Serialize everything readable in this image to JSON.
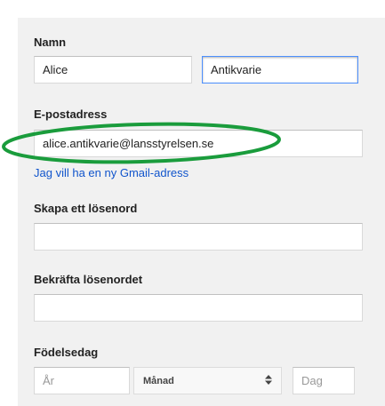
{
  "name_section": {
    "label": "Namn",
    "first_name_value": "Alice",
    "last_name_value": "Antikvarie"
  },
  "email_section": {
    "label": "E-postadress",
    "value": "alice.antikvarie@lansstyrelsen.se",
    "new_gmail_link": "Jag vill ha en ny Gmail-adress"
  },
  "password_section": {
    "label": "Skapa ett lösenord",
    "value": ""
  },
  "confirm_section": {
    "label": "Bekräfta lösenordet",
    "value": ""
  },
  "birthday_section": {
    "label": "Födelsedag",
    "year_placeholder": "År",
    "month_selected": "Månad",
    "day_placeholder": "Dag"
  },
  "colors": {
    "panel_background": "#f1f1f1",
    "link": "#1155cc",
    "focus_border": "#4d90fe",
    "annotation_ring": "#1a9c3c"
  },
  "icons": {
    "select_arrows": "up-down-arrows-icon"
  }
}
